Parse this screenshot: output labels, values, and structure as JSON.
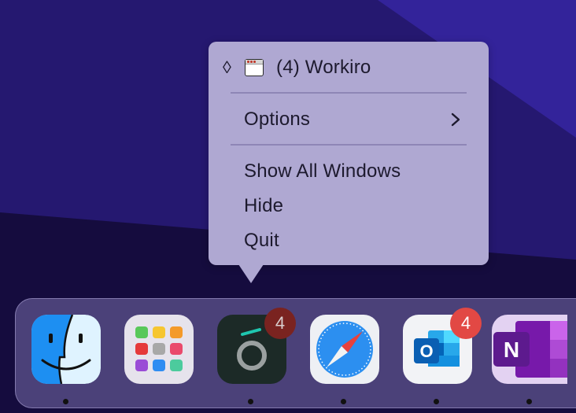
{
  "menu": {
    "window_item": "(4) Workiro",
    "items": [
      "Options",
      "Show All Windows",
      "Hide",
      "Quit"
    ]
  },
  "dock": {
    "apps": [
      {
        "name": "Finder",
        "icon": "finder-icon",
        "running": true
      },
      {
        "name": "Launchpad",
        "icon": "launchpad-icon",
        "running": false
      },
      {
        "name": "Workiro",
        "icon": "workiro-icon",
        "badge": "4",
        "running": true
      },
      {
        "name": "Safari",
        "icon": "safari-icon",
        "running": true
      },
      {
        "name": "Outlook",
        "icon": "outlook-icon",
        "badge": "4",
        "running": true
      },
      {
        "name": "OneNote",
        "icon": "onenote-icon",
        "running": true
      }
    ]
  },
  "colors": {
    "menu_bg": "#afa8d2",
    "badge_red": "#e24844",
    "wallpaper_dark": "#1a1050",
    "wallpaper_light": "#2e1f8a"
  }
}
